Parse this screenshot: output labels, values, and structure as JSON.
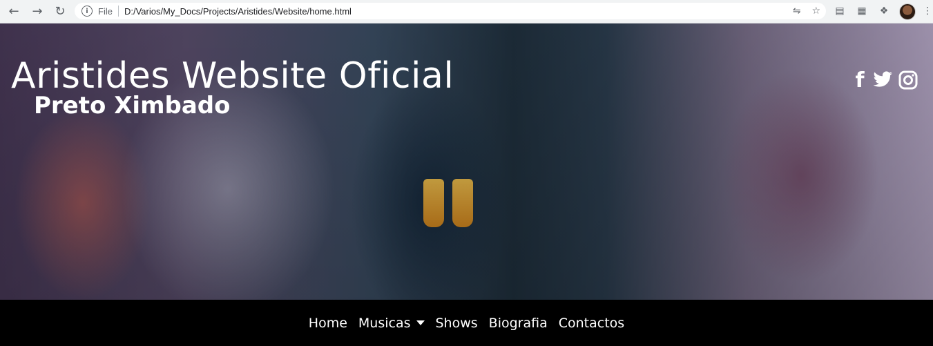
{
  "browser": {
    "url_scheme": "File",
    "url": "D:/Varios/My_Docs/Projects/Aristides/Website/home.html",
    "icons": [
      "back-icon",
      "forward-icon",
      "reload-icon",
      "info-icon",
      "translate-icon",
      "star-icon",
      "pdf-extension-icon",
      "bag-extension-icon",
      "puzzle-extension-icon",
      "profile-avatar",
      "kebab-menu-icon"
    ]
  },
  "header": {
    "title": "Aristides Website Oficial",
    "subtitle": "Preto Ximbado",
    "social": [
      "facebook-icon",
      "twitter-icon",
      "instagram-icon"
    ]
  },
  "nav": {
    "items": [
      {
        "label": "Home"
      },
      {
        "label": "Musicas"
      },
      {
        "label": "Shows"
      },
      {
        "label": "Biografia"
      },
      {
        "label": "Contactos"
      }
    ]
  },
  "colors": {
    "navbar_bg": "#000000",
    "text": "#ffffff"
  }
}
